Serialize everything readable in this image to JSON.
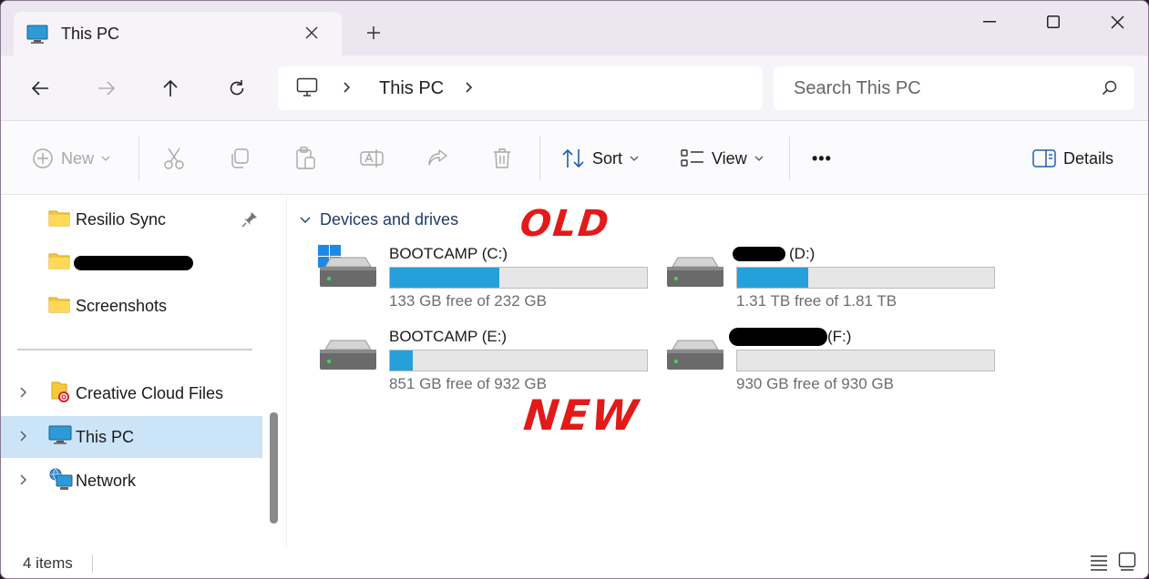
{
  "tab": {
    "title": "This PC",
    "close_icon": "close-icon"
  },
  "address": {
    "crumb": "This PC"
  },
  "search": {
    "placeholder": "Search This PC"
  },
  "toolbar": {
    "new_label": "New",
    "sort_label": "Sort",
    "view_label": "View",
    "more_label": "•••",
    "details_label": "Details"
  },
  "sidebar": {
    "items": [
      {
        "label": "Resilio Sync",
        "pinned": true
      },
      {
        "label": "",
        "redacted": true
      },
      {
        "label": "Screenshots"
      },
      {
        "label": "Creative Cloud Files"
      },
      {
        "label": "This PC",
        "selected": true
      },
      {
        "label": "Network"
      }
    ]
  },
  "main": {
    "group_header": "Devices and drives",
    "drives": [
      {
        "name": "BOOTCAMP (C:)",
        "free": "133 GB free of 232 GB",
        "used_fraction": 0.427
      },
      {
        "name": "(D:)",
        "free": "1.31 TB free of 1.81 TB",
        "used_fraction": 0.276,
        "name_redacted": true
      },
      {
        "name": "BOOTCAMP (E:)",
        "free": "851 GB free of 932 GB",
        "used_fraction": 0.087
      },
      {
        "name": "(F:)",
        "free": "930 GB free of 930 GB",
        "used_fraction": 0.0,
        "name_redacted": true
      }
    ],
    "annotation_old": "OLD",
    "annotation_new": "NEW"
  },
  "status": {
    "count": "4 items"
  },
  "colors": {
    "accent": "#26a0da",
    "selected": "#cce4f7",
    "annotation": "#e21a1a"
  }
}
